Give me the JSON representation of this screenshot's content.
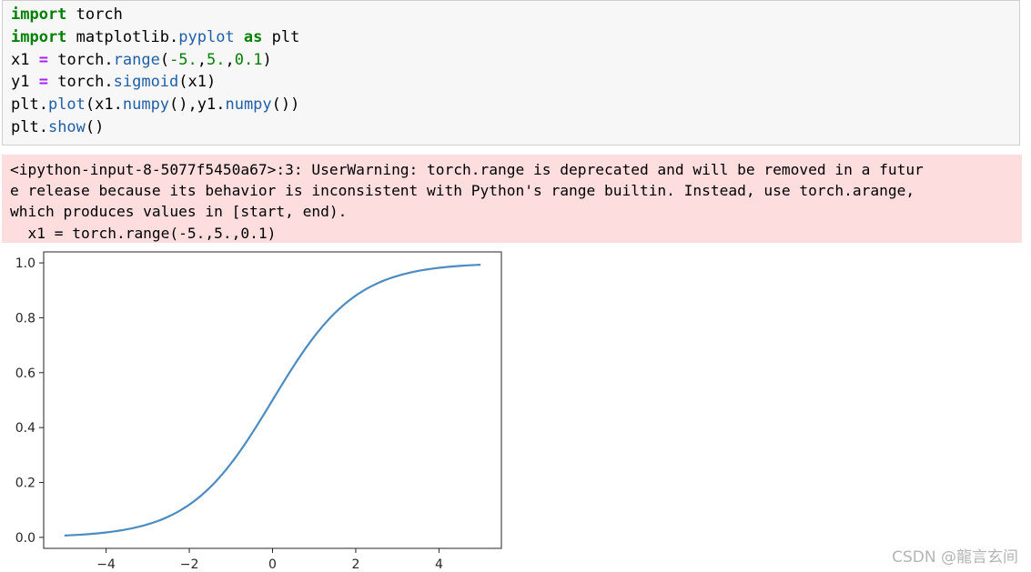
{
  "code": {
    "line1": {
      "kw": "import",
      "rest": " torch"
    },
    "line2": {
      "kw": "import",
      "mid": " matplotlib.",
      "fn": "pyplot",
      "kw2": " as",
      "rest": " plt"
    },
    "line3": {
      "a": "x1 ",
      "op": "=",
      "b": " torch.",
      "fn": "range",
      "p1": "(",
      "n1": "-5.",
      "c1": ",",
      "n2": "5.",
      "c2": ",",
      "n3": "0.1",
      "p2": ")"
    },
    "line4": {
      "a": "y1 ",
      "op": "=",
      "b": " torch.",
      "fn": "sigmoid",
      "p1": "(",
      "arg": "x1",
      "p2": ")"
    },
    "line5": {
      "a": "plt.",
      "fn1": "plot",
      "b": "(x1.",
      "fn2": "numpy",
      "c": "(),y1.",
      "fn3": "numpy",
      "d": "())"
    },
    "line6": {
      "a": "plt.",
      "fn": "show",
      "b": "()"
    }
  },
  "warning": {
    "line1": "<ipython-input-8-5077f5450a67>:3: UserWarning: torch.range is deprecated and will be removed in a futur",
    "line2": "e release because its behavior is inconsistent with Python's range builtin. Instead, use torch.arange,",
    "line3": "which produces values in [start, end).",
    "line4": "  x1 = torch.range(-5.,5.,0.1)"
  },
  "chart_data": {
    "type": "line",
    "function": "sigmoid",
    "x_start": -5.0,
    "x_end": 5.0,
    "x_step": 0.1,
    "xlim": [
      -5.5,
      5.5
    ],
    "ylim": [
      -0.04,
      1.04
    ],
    "xticks": [
      -4,
      -2,
      0,
      2,
      4
    ],
    "xtick_labels": [
      "−4",
      "−2",
      "0",
      "2",
      "4"
    ],
    "yticks": [
      0.0,
      0.2,
      0.4,
      0.6,
      0.8,
      1.0
    ],
    "ytick_labels": [
      "0.0",
      "0.2",
      "0.4",
      "0.6",
      "0.8",
      "1.0"
    ],
    "grid": false,
    "line_color": "#4c8cc2",
    "title": "",
    "xlabel": "",
    "ylabel": ""
  },
  "watermark": "CSDN @龍言玄间"
}
